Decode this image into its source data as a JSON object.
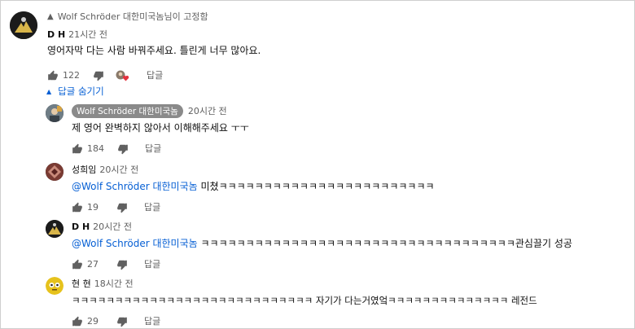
{
  "pinned_label": "Wolf Schröder 대한미국놈님이 고정함",
  "top": {
    "author": "D H",
    "time": "21시간 전",
    "text": "영어자막 다는 사람 바꿔주세요. 틀린게 너무 많아요.",
    "likes": "122",
    "reply": "답글"
  },
  "replies_toggle": "답글 숨기기",
  "replies": [
    {
      "author": "Wolf Schröder 대한미국놈",
      "time": "20시간 전",
      "mention": "",
      "text": "제 영어 완벽하지 않아서 이해해주세요 ㅜㅜ",
      "likes": "184",
      "reply": "답글"
    },
    {
      "author": "성희임",
      "time": "20시간 전",
      "mention": "@Wolf Schröder 대한미국놈",
      "text": " 미쳤ㅋㅋㅋㅋㅋㅋㅋㅋㅋㅋㅋㅋㅋㅋㅋㅋㅋㅋㅋㅋㅋㅋㅋㅋ",
      "likes": "19",
      "reply": "답글"
    },
    {
      "author": "D H",
      "time": "20시간 전",
      "mention": "@Wolf Schröder 대한미국놈",
      "text": " ㅋㅋㅋㅋㅋㅋㅋㅋㅋㅋㅋㅋㅋㅋㅋㅋㅋㅋㅋㅋㅋㅋㅋㅋㅋㅋㅋㅋㅋㅋㅋㅋㅋㅋㅋ관심끌기 성공",
      "likes": "27",
      "reply": "답글"
    },
    {
      "author": "현 현",
      "time": "18시간 전",
      "mention": "",
      "text": "ㅋㅋㅋㅋㅋㅋㅋㅋㅋㅋㅋㅋㅋㅋㅋㅋㅋㅋㅋㅋㅋㅋㅋㅋㅋㅋㅋㅋ 자기가 다는거였엌ㅋㅋㅋㅋㅋㅋㅋㅋㅋㅋㅋㅋㅋㅋ 레전드",
      "likes": "29",
      "reply": "답글"
    }
  ],
  "colors": {
    "link": "#065fd4",
    "meta": "#606060",
    "heart": "#e3333e",
    "chip": "#8a8a8a"
  },
  "icons": [
    "pin-icon",
    "thumbs-up-icon",
    "thumbs-down-icon",
    "creator-heart-icon",
    "caret-up-icon"
  ]
}
